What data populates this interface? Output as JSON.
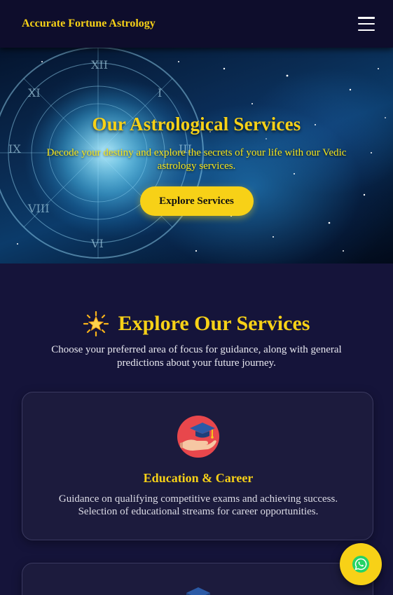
{
  "header": {
    "brand": "Accurate Fortune Astrology",
    "menu_icon": "hamburger-menu-icon"
  },
  "hero": {
    "title": "Our Astrological Services",
    "subtitle": "Decode your destiny and explore the secrets of your life with our Vedic astrology services.",
    "button_label": "Explore Services"
  },
  "services": {
    "title_icon": "glowing-star-icon",
    "title": "Explore Our Services",
    "subtitle": "Choose your preferred area of focus for guidance, along with general predictions about your future journey.",
    "cards": [
      {
        "icon": "graduation-cap-hand-icon",
        "title": "Education & Career",
        "text": "Guidance on qualifying competitive exams and achieving success. Selection of educational streams for career opportunities."
      },
      {
        "icon": "graduation-cap-icon"
      }
    ]
  },
  "whatsapp": {
    "icon": "whatsapp-icon"
  },
  "colors": {
    "accent": "#f7d117",
    "background": "#15143a",
    "header_bg": "#0e0d2c",
    "card_bg": "#1c1b3d"
  }
}
